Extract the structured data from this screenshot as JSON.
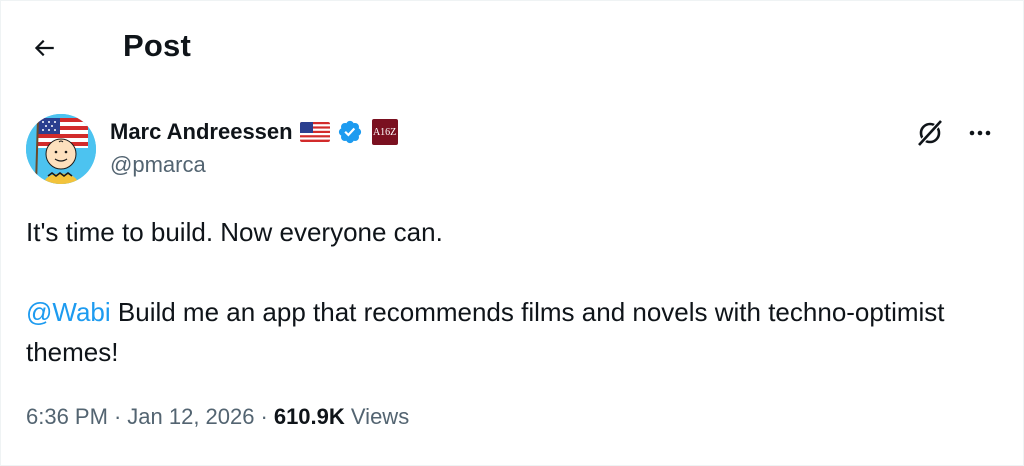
{
  "header": {
    "back_icon": "arrow-left-icon",
    "title": "Post"
  },
  "author": {
    "display_name": "Marc Andreessen",
    "handle": "@pmarca",
    "flag_icon": "us-flag-icon",
    "verified_icon": "verified-badge-icon",
    "verified_color": "#1d9bf0",
    "affiliate_badge_text": "A16Z",
    "affiliate_badge_color": "#7a1020",
    "avatar_icon": "cartoon-avatar"
  },
  "actions": {
    "grok_icon": "grok-icon",
    "more_icon": "more-dots-icon"
  },
  "tweet": {
    "line1": "It's time to build. Now everyone can.",
    "mention": "@Wabi",
    "line2": " Build me an app that recommends films and novels with techno-optimist themes!",
    "mention_color": "#1d9bf0"
  },
  "meta": {
    "time": "6:36 PM",
    "separator": "·",
    "date": "Jan 12, 2026",
    "views_count": "610.9K",
    "views_label": "Views"
  }
}
